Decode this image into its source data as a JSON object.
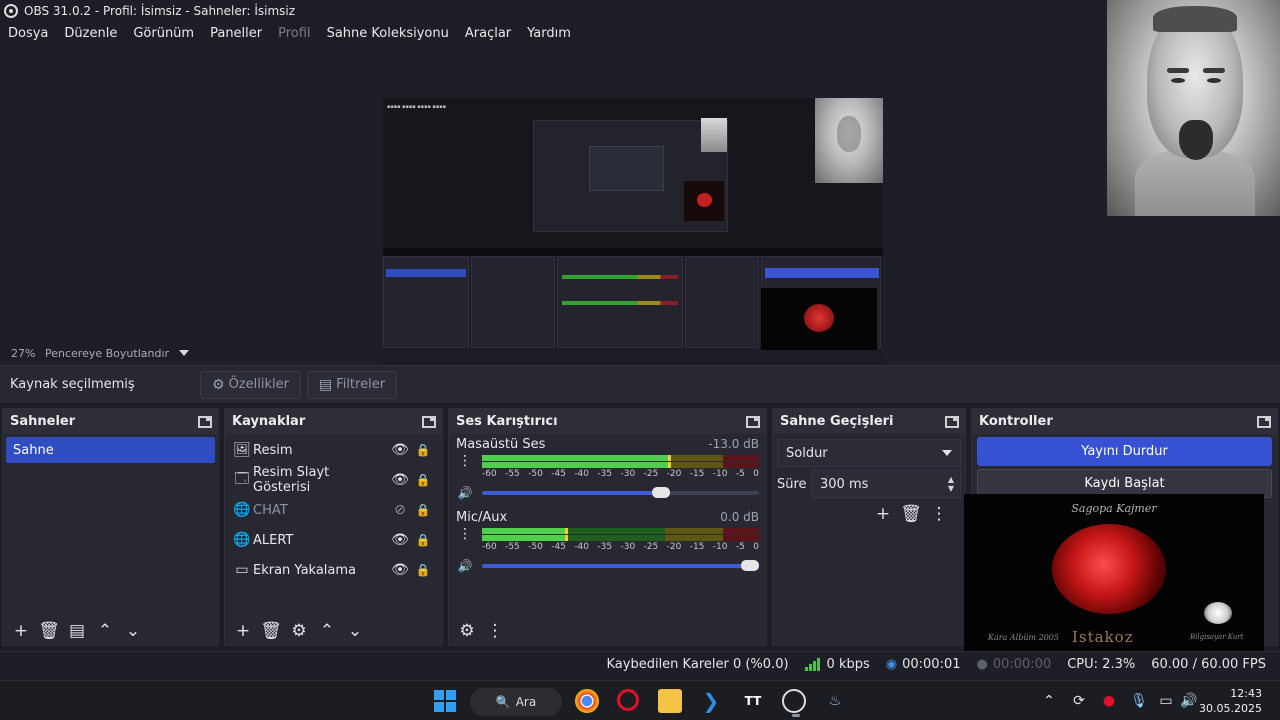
{
  "window": {
    "title": "OBS 31.0.2 - Profil: İsimsiz - Sahneler: İsimsiz"
  },
  "menu": [
    {
      "label": "Dosya",
      "disabled": false
    },
    {
      "label": "Düzenle",
      "disabled": false
    },
    {
      "label": "Görünüm",
      "disabled": false
    },
    {
      "label": "Paneller",
      "disabled": false
    },
    {
      "label": "Profil",
      "disabled": true
    },
    {
      "label": "Sahne Koleksiyonu",
      "disabled": false
    },
    {
      "label": "Araçlar",
      "disabled": false
    },
    {
      "label": "Yardım",
      "disabled": false
    }
  ],
  "preview": {
    "zoom": "27%",
    "fit_label": "Pencereye Boyutlandır"
  },
  "context": {
    "no_source": "Kaynak seçilmemiş",
    "properties": "Özellikler",
    "filters": "Filtreler"
  },
  "scenes": {
    "title": "Sahneler",
    "items": [
      "Sahne"
    ]
  },
  "sources": {
    "title": "Kaynaklar",
    "items": [
      {
        "name": "Resim",
        "icon": "image-icon",
        "visible": true
      },
      {
        "name": "Resim Slayt Gösterisi",
        "icon": "slideshow-icon",
        "visible": true
      },
      {
        "name": "CHAT",
        "icon": "browser-icon",
        "visible": false
      },
      {
        "name": "ALERT",
        "icon": "browser-icon",
        "visible": true
      },
      {
        "name": "Ekran Yakalama",
        "icon": "monitor-icon",
        "visible": true
      }
    ]
  },
  "mixer": {
    "title": "Ses Karıştırıcı",
    "ticks": [
      "-60",
      "-55",
      "-50",
      "-45",
      "-40",
      "-35",
      "-30",
      "-25",
      "-20",
      "-15",
      "-10",
      "-5",
      "0"
    ],
    "channels": [
      {
        "name": "Masaüstü Ses",
        "db": "-13.0 dB",
        "level": 0.67,
        "volume": 0.68
      },
      {
        "name": "Mic/Aux",
        "db": "0.0 dB",
        "level": 0.3,
        "volume": 1.0
      }
    ]
  },
  "transitions": {
    "title": "Sahne Geçişleri",
    "selected": "Soldur",
    "duration_label": "Süre",
    "duration": "300 ms"
  },
  "controls": {
    "title": "Kontroller",
    "stop_stream": "Yayını Durdur",
    "start_record": "Kaydı Başlat"
  },
  "overlay_lobster": {
    "title": "Sagopa Kajmer",
    "left_text": "Kara Albüm 2005",
    "name": "Istakoz",
    "right_text": "Bilgisayar Kurt"
  },
  "status": {
    "dropped": "Kaybedilen Kareler 0 (%0.0)",
    "bitrate": "0 kbps",
    "stream_time": "00:00:01",
    "record_time": "00:00:00",
    "cpu": "CPU: 2.3%",
    "fps": "60.00 / 60.00 FPS"
  },
  "taskbar": {
    "search": "Ara",
    "time": "12:43",
    "date": "30.05.2025"
  },
  "colors": {
    "accent": "#3652d2",
    "panel": "#272831",
    "background": "#1e1f26",
    "meter_green": "#4ed04a"
  }
}
